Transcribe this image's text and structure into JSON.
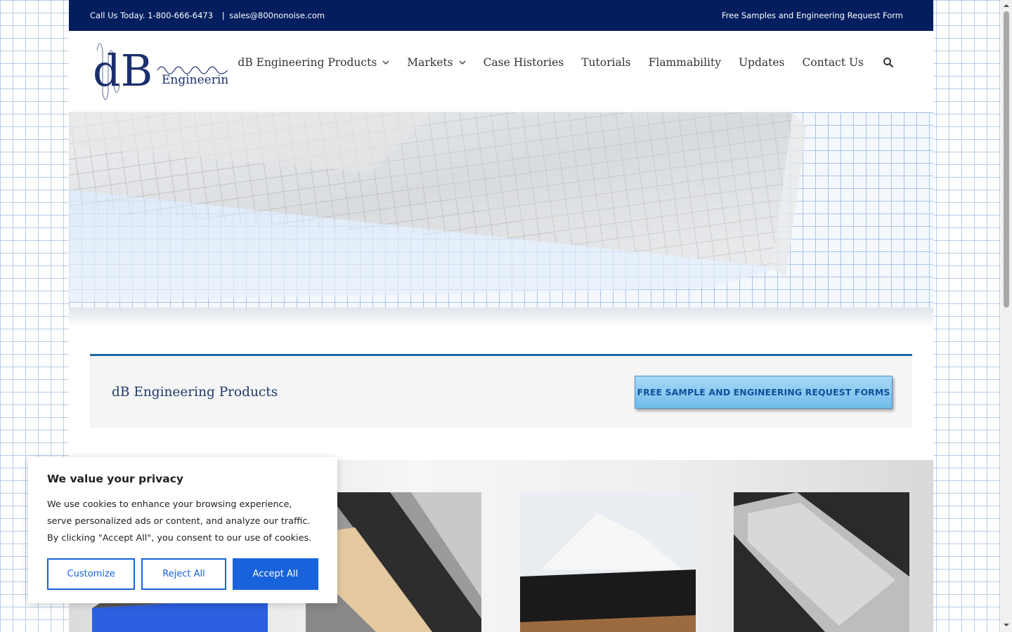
{
  "topbar": {
    "phone_text": "Call Us Today. 1-800-666-6473",
    "separator": "|",
    "email": "sales@800nonoise.com",
    "samples_link": "Free Samples and Engineering Request Form"
  },
  "logo": {
    "main": "dB",
    "sub": "Engineering"
  },
  "nav": {
    "items": [
      {
        "label": "dB Engineering Products",
        "has_dropdown": true
      },
      {
        "label": "Markets",
        "has_dropdown": true
      },
      {
        "label": "Case Histories",
        "has_dropdown": false
      },
      {
        "label": "Tutorials",
        "has_dropdown": false
      },
      {
        "label": "Flammability",
        "has_dropdown": false
      },
      {
        "label": "Updates",
        "has_dropdown": false
      },
      {
        "label": "Contact Us",
        "has_dropdown": false
      }
    ],
    "search_icon": "search-icon"
  },
  "callout": {
    "title": "dB Engineering Products",
    "button_label": "FREE SAMPLE AND ENGINEERING REQUEST FORMS"
  },
  "cookie_banner": {
    "title": "We value your privacy",
    "body": "We use cookies to enhance your browsing experience, serve personalized ads or content, and analyze our traffic. By clicking \"Accept All\", you consent to our use of cookies.",
    "customize_label": "Customize",
    "reject_label": "Reject All",
    "accept_label": "Accept All"
  },
  "colors": {
    "topbar_bg": "#031e5f",
    "accent_blue": "#1863dc",
    "callout_border": "#1a6aa6",
    "logo_navy": "#1b2f6e"
  }
}
